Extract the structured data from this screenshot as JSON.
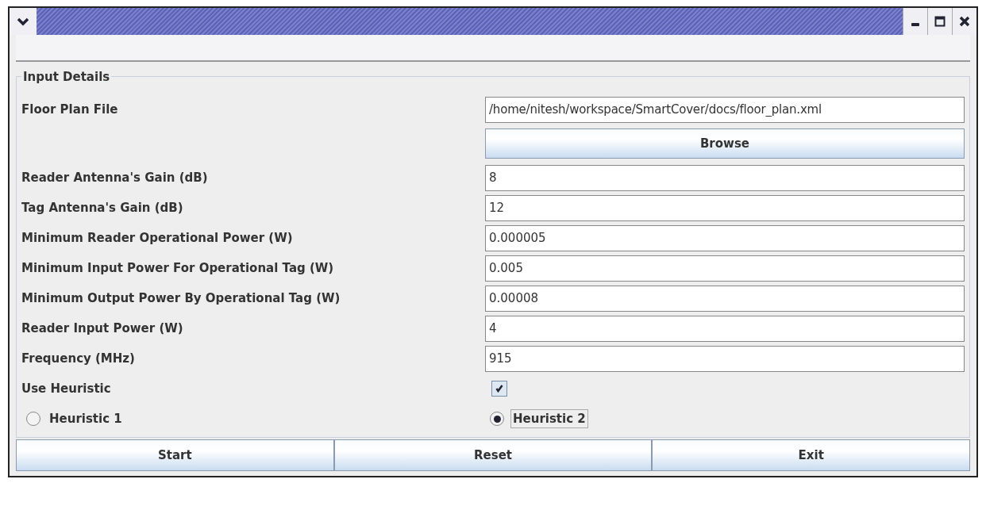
{
  "group_title": "Input Details",
  "floor_plan": {
    "label": "Floor Plan File",
    "value": "/home/nitesh/workspace/SmartCover/docs/floor_plan.xml",
    "button": "Browse"
  },
  "fields": [
    {
      "label": "Reader Antenna's Gain (dB)",
      "value": "8"
    },
    {
      "label": "Tag Antenna's Gain (dB)",
      "value": "12"
    },
    {
      "label": "Minimum Reader Operational Power (W)",
      "value": "0.000005"
    },
    {
      "label": "Minimum Input Power For Operational Tag (W)",
      "value": "0.005"
    },
    {
      "label": "Minimum Output Power By Operational Tag (W)",
      "value": "0.00008"
    },
    {
      "label": "Reader Input Power (W)",
      "value": "4"
    },
    {
      "label": "Frequency (MHz)",
      "value": "915"
    }
  ],
  "use_heuristic": {
    "label": "Use Heuristic",
    "checked": true
  },
  "heuristics": [
    {
      "label": "Heuristic 1",
      "selected": false,
      "focused": false
    },
    {
      "label": "Heuristic 2",
      "selected": true,
      "focused": true
    }
  ],
  "buttons": [
    "Start",
    "Reset",
    "Exit"
  ]
}
